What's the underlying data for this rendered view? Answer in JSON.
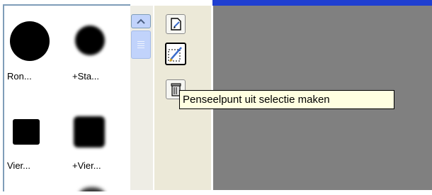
{
  "brushes": [
    {
      "label": "Ron...",
      "shape": "round",
      "soft": false
    },
    {
      "label": "+Sta...",
      "shape": "round",
      "soft": true
    },
    {
      "label": "Vier...",
      "shape": "square",
      "soft": false
    },
    {
      "label": "+Vier...",
      "shape": "square",
      "soft": true
    }
  ],
  "tooltip": {
    "text": "Penseelpunt uit selectie maken"
  },
  "toolbar": {
    "buttons": [
      {
        "name": "new-brush",
        "icon": "new-document-icon"
      },
      {
        "name": "brush-from-selection",
        "icon": "brush-selection-icon",
        "active": true
      },
      {
        "name": "delete-brush",
        "icon": "trash-icon"
      }
    ]
  },
  "colors": {
    "canvas": "#808080",
    "frame": "#1f3fd1",
    "tooltip_bg": "#ffffe1"
  }
}
